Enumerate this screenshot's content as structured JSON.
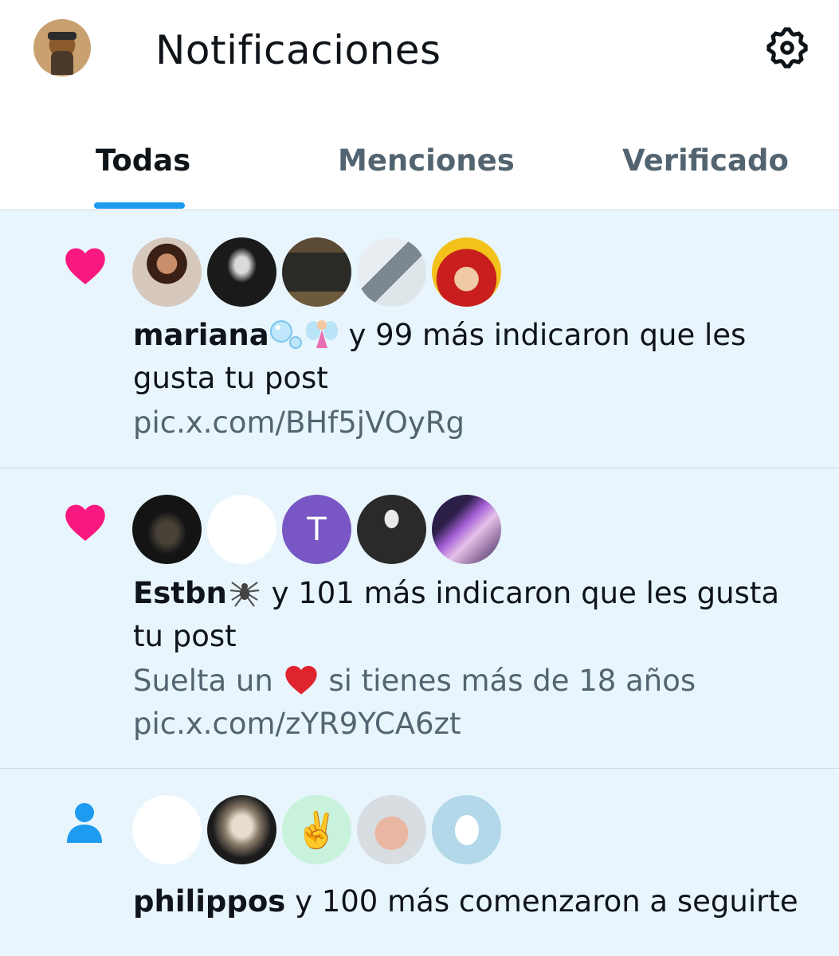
{
  "header": {
    "title": "Notificaciones",
    "profile_icon": "profile-avatar",
    "settings_icon": "gear-icon"
  },
  "tabs": [
    {
      "label": "Todas",
      "active": true
    },
    {
      "label": "Menciones",
      "active": false
    },
    {
      "label": "Verificado",
      "active": false
    }
  ],
  "colors": {
    "accent": "#1d9bf0",
    "like": "#f91880",
    "unread_bg": "#e8f5fd",
    "secondary_text": "#536471"
  },
  "notifications": [
    {
      "type": "like",
      "icon": "heart-icon",
      "user": "mariana",
      "user_emoji": [
        "bubbles-emoji",
        "fairy-emoji"
      ],
      "action": "y 99 más indicaron que les gusta tu post",
      "lines": [
        "pic.x.com/BHf5jVOyRg"
      ]
    },
    {
      "type": "like",
      "icon": "heart-icon",
      "user": "Estbn",
      "user_emoji": [
        "spider-emoji"
      ],
      "action": "y 101 más indicaron que les gusta tu post",
      "line1_before": "Suelta un",
      "line1_after": "si tienes más de 18 años",
      "lines": [
        "pic.x.com/zYR9YCA6zt"
      ],
      "avatar_letter": "T"
    },
    {
      "type": "follow",
      "icon": "person-icon",
      "user": "philippos",
      "action": "y 100 más comenzaron a seguirte",
      "avatar_emoji": "✌️"
    }
  ]
}
